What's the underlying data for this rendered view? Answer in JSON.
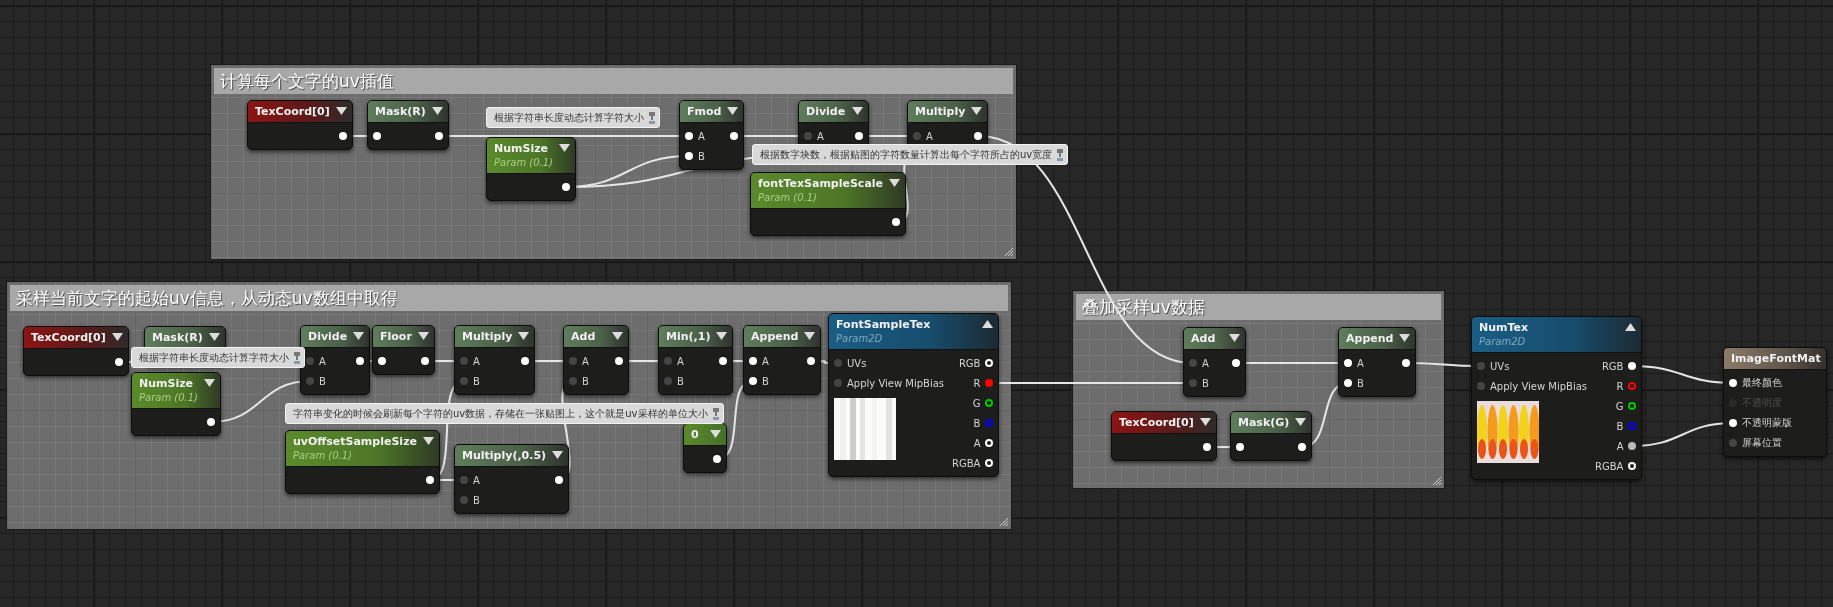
{
  "comments": [
    {
      "title": "计算每个文字的uv插值"
    },
    {
      "title": "采样当前文字的起始uv信息，从动态uv数组中取得"
    },
    {
      "title": "叠加采样uv数据"
    }
  ],
  "nodes": [
    {
      "kind": "texcoord",
      "title": "TexCoord[0]",
      "outputs": [
        {
          "connected": true
        }
      ]
    },
    {
      "kind": "function",
      "title": "Mask(R)",
      "inputs": [
        {
          "connected": true
        }
      ],
      "outputs": [
        {
          "connected": true
        }
      ]
    },
    {
      "kind": "param",
      "title": "NumSize",
      "subtitle": "Param (0.1)",
      "outputs": [
        {
          "connected": true
        }
      ]
    },
    {
      "kind": "function",
      "title": "Fmod",
      "inputs": [
        {
          "label": "A",
          "connected": true
        },
        {
          "label": "B",
          "connected": true
        }
      ],
      "outputs": [
        {
          "connected": true
        }
      ]
    },
    {
      "kind": "function",
      "title": "Divide",
      "inputs": [
        {
          "label": "A",
          "connected": false
        }
      ],
      "outputs": [
        {
          "connected": true
        }
      ]
    },
    {
      "kind": "function",
      "title": "Multiply",
      "inputs": [
        {
          "label": "A",
          "connected": false
        }
      ],
      "outputs": [
        {
          "connected": true
        }
      ]
    },
    {
      "kind": "param",
      "title": "fontTexSampleScale",
      "subtitle": "Param (0.1)",
      "outputs": [
        {
          "connected": true
        }
      ]
    },
    {
      "kind": "texcoord",
      "title": "TexCoord[0]",
      "outputs": [
        {
          "connected": true
        }
      ]
    },
    {
      "kind": "function",
      "title": "Mask(R)"
    },
    {
      "kind": "param",
      "title": "NumSize",
      "subtitle": "Param (0.1)",
      "outputs": [
        {
          "connected": true
        }
      ]
    },
    {
      "kind": "function",
      "title": "Divide",
      "inputs": [
        {
          "label": "A",
          "connected": false
        },
        {
          "label": "B",
          "connected": false
        }
      ],
      "outputs": [
        {
          "connected": true
        }
      ]
    },
    {
      "kind": "function",
      "title": "Floor",
      "inputs": [
        {
          "connected": true
        }
      ],
      "outputs": [
        {
          "connected": true
        }
      ]
    },
    {
      "kind": "function",
      "title": "Multiply",
      "inputs": [
        {
          "label": "A",
          "connected": false
        },
        {
          "label": "B",
          "connected": false
        }
      ],
      "outputs": [
        {
          "connected": true
        }
      ]
    },
    {
      "kind": "function",
      "title": "Add",
      "inputs": [
        {
          "label": "A",
          "connected": false
        },
        {
          "label": "B",
          "connected": false
        }
      ],
      "outputs": [
        {
          "connected": true
        }
      ]
    },
    {
      "kind": "function",
      "title": "Min(,1)",
      "inputs": [
        {
          "label": "A",
          "connected": false
        },
        {
          "label": "B",
          "connected": false
        }
      ],
      "outputs": [
        {
          "connected": true
        }
      ]
    },
    {
      "kind": "function",
      "title": "Append",
      "inputs": [
        {
          "label": "A",
          "connected": true
        },
        {
          "label": "B",
          "connected": true
        }
      ],
      "outputs": [
        {
          "connected": true
        }
      ]
    },
    {
      "kind": "texture",
      "title": "FontSampleTex",
      "subtitle": "Param2D",
      "preview": {
        "kind": "picture"
      },
      "inputs": [
        {
          "label": "UVs",
          "connected": false
        },
        {
          "label": "Apply View MipBias",
          "connected": false
        }
      ],
      "outputs": [
        {
          "label": "RGB",
          "connected": false,
          "color": "#ffffff"
        },
        {
          "label": "R",
          "connected": true,
          "color": "#ff0000"
        },
        {
          "label": "G",
          "connected": false,
          "color": "#00c800"
        },
        {
          "label": "B",
          "connected": false,
          "color": "#0000ff"
        },
        {
          "label": "A",
          "connected": false,
          "color": "#ffffff"
        },
        {
          "label": "RGBA",
          "connected": false,
          "color": "#ffffff"
        }
      ]
    },
    {
      "kind": "param",
      "title": "uvOffsetSampleSize",
      "subtitle": "Param (0.1)",
      "outputs": [
        {
          "connected": true
        }
      ]
    },
    {
      "kind": "function",
      "title": "Multiply(,0.5)",
      "inputs": [
        {
          "label": "A",
          "connected": false
        },
        {
          "label": "B",
          "connected": false
        }
      ],
      "outputs": [
        {
          "connected": true
        }
      ]
    },
    {
      "kind": "constant",
      "title": "0",
      "outputs": [
        {
          "connected": true
        }
      ]
    },
    {
      "kind": "function",
      "title": "Add",
      "inputs": [
        {
          "label": "A",
          "connected": false
        },
        {
          "label": "B",
          "connected": false
        }
      ],
      "outputs": [
        {
          "connected": true
        }
      ]
    },
    {
      "kind": "function",
      "title": "Append",
      "inputs": [
        {
          "label": "A",
          "connected": true
        },
        {
          "label": "B",
          "connected": true
        }
      ],
      "outputs": [
        {
          "connected": true
        }
      ]
    },
    {
      "kind": "texcoord",
      "title": "TexCoord[0]",
      "outputs": [
        {
          "connected": true
        }
      ]
    },
    {
      "kind": "function",
      "title": "Mask(G)",
      "inputs": [
        {
          "connected": true
        }
      ],
      "outputs": [
        {
          "connected": true
        }
      ]
    },
    {
      "kind": "texture",
      "title": "NumTex",
      "subtitle": "Param2D",
      "preview": {
        "kind": "picture"
      },
      "inputs": [
        {
          "label": "UVs",
          "connected": false
        },
        {
          "label": "Apply View MipBias",
          "connected": false
        }
      ],
      "outputs": [
        {
          "label": "RGB",
          "connected": true,
          "color": "#ffffff"
        },
        {
          "label": "R",
          "connected": false,
          "color": "#ff0000"
        },
        {
          "label": "G",
          "connected": false,
          "color": "#00c800"
        },
        {
          "label": "B",
          "connected": false,
          "color": "#0000ff"
        },
        {
          "label": "A",
          "connected": true,
          "color": "#bbbbbb"
        },
        {
          "label": "RGBA",
          "connected": false,
          "color": "#ffffff"
        }
      ]
    },
    {
      "kind": "material",
      "title": "ImageFontMat",
      "inputs": [
        {
          "label": "最终颜色",
          "connected": true,
          "disabled": false
        },
        {
          "label": "不透明度",
          "connected": false,
          "disabled": true
        },
        {
          "label": "不透明蒙版",
          "connected": true,
          "disabled": false
        },
        {
          "label": "屏幕位置",
          "connected": false,
          "disabled": false
        }
      ]
    }
  ],
  "notes": [
    {
      "text": "根据字符串长度动态计算字符大小"
    },
    {
      "text": "根据数字块数，根据贴图的字符数量计算出每个字符所占的uv宽度"
    },
    {
      "text": "根据字符串长度动态计算字符大小"
    },
    {
      "text": "字符串变化的时候会刷新每个字符的uv数据，存储在一张贴图上，这个就是uv采样的单位大小"
    }
  ]
}
